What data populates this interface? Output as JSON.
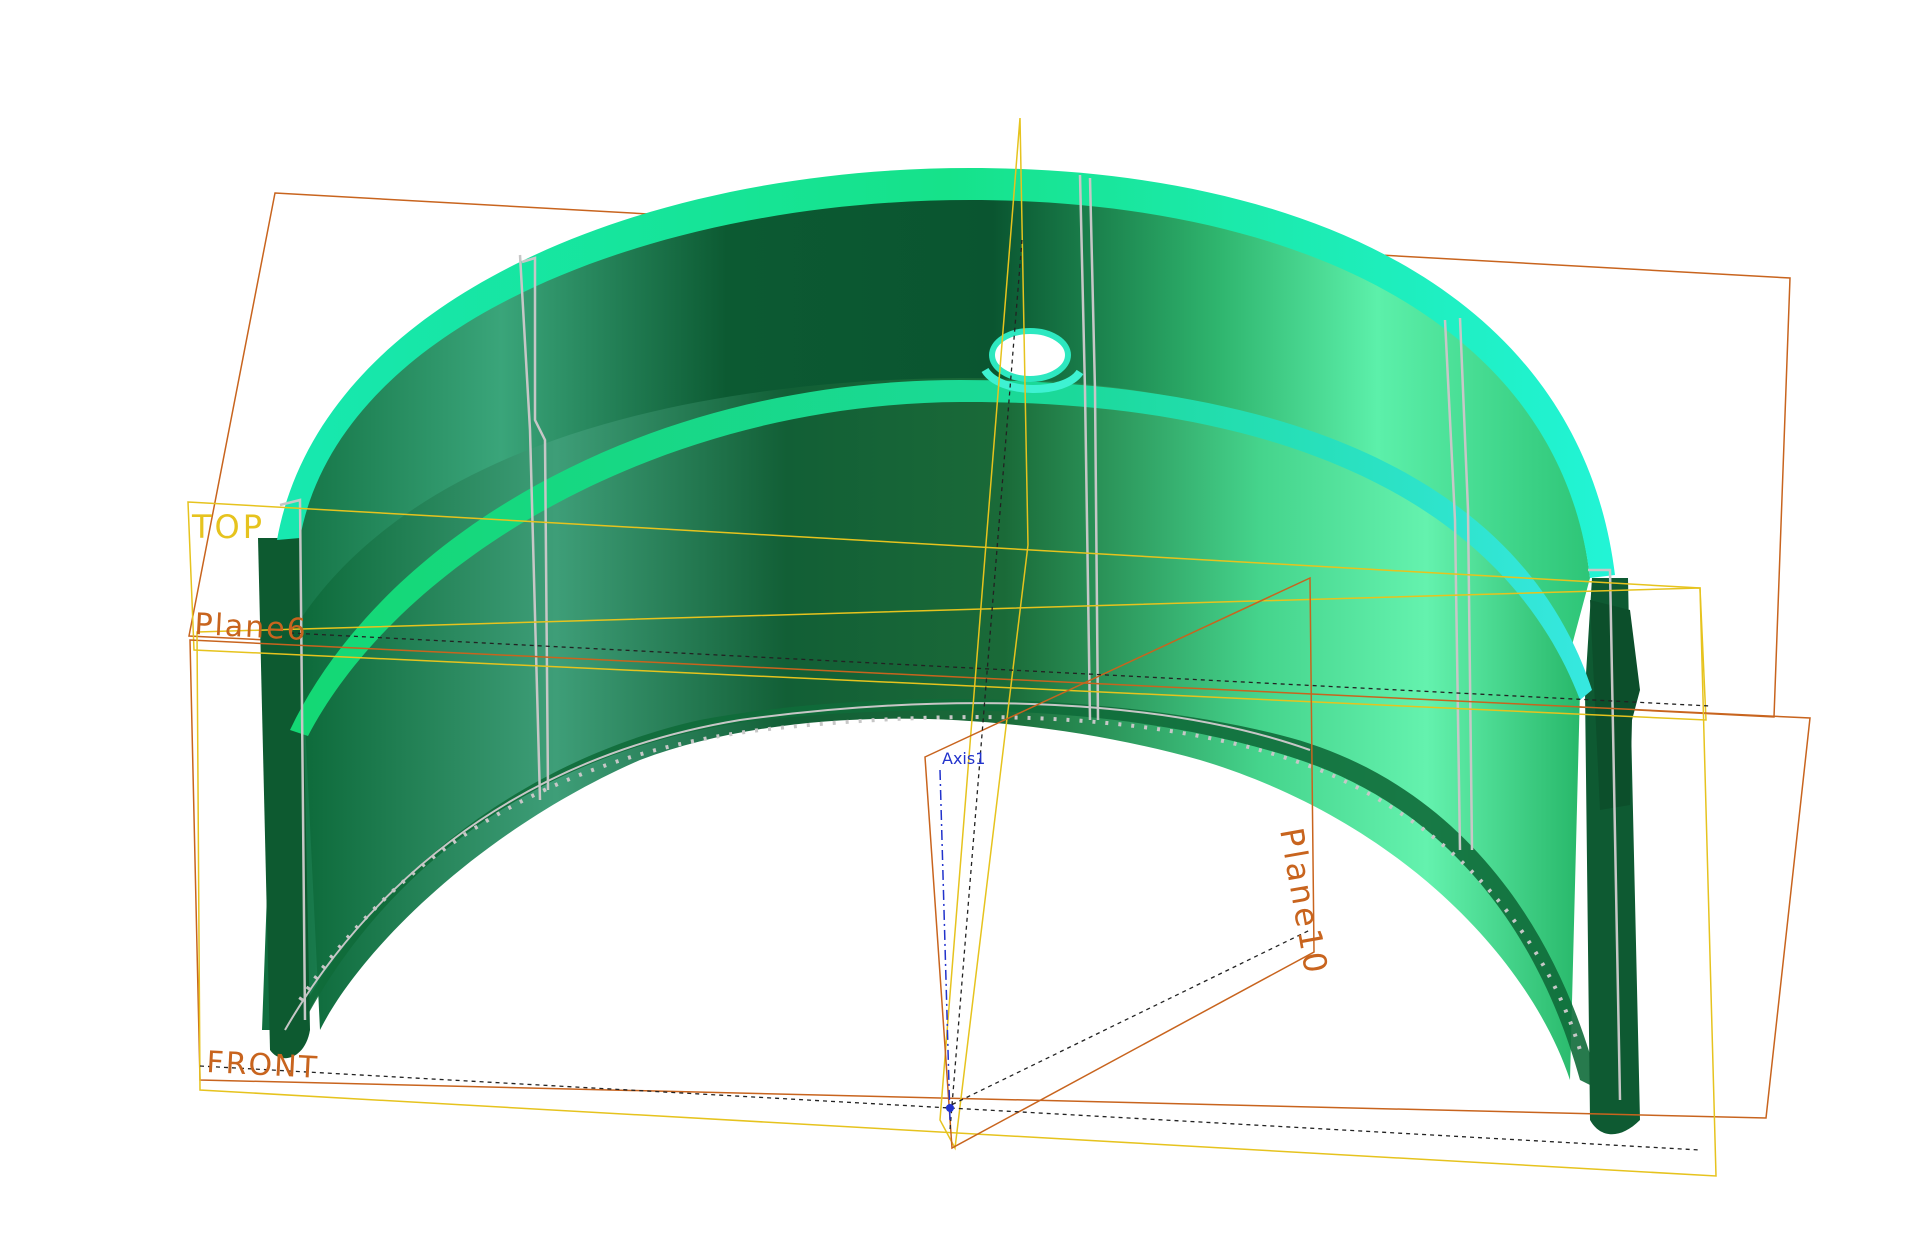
{
  "viewport": {
    "labels": {
      "top_plane": "TOP",
      "plane6": "Plane6",
      "front_plane": "FRONT",
      "plane10": "Plane10",
      "axis1": "Axis1"
    }
  },
  "colors": {
    "background": "#ffffff",
    "part_dark": "#0e5a32",
    "part_mid": "#18804a",
    "part_light": "#59f0a8",
    "rim_cyan": "#19f0cc",
    "rim_green": "#12e07c",
    "plane_orange": "#c8641e",
    "plane_yellow": "#e6c31e",
    "axis_blue": "#2233cc",
    "edge_gray": "#c7c7c7"
  }
}
